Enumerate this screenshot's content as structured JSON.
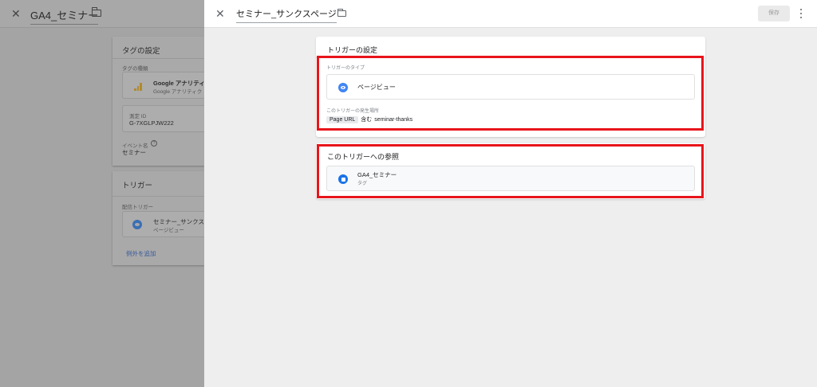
{
  "background": {
    "window_title": "GA4_セミナー",
    "tag_config": {
      "title": "タグの設定",
      "tag_type_label": "タグの種類",
      "tag_name": "Google アナリティ",
      "tag_sub": "Google アナリティク",
      "measure_label": "測定 ID",
      "measure_id": "G-7XGLPJW222",
      "event_label": "イベント名",
      "event_value": "セミナー",
      "tag_icon": "google-analytics-icon"
    },
    "trigger": {
      "title": "トリガー",
      "firing_label": "配信トリガー",
      "trigger_name": "セミナー_サンクス",
      "trigger_type": "ページビュー",
      "add_exception": "例外を追加"
    }
  },
  "panel": {
    "title": "セミナー_サンクスページ",
    "save_label": "保存",
    "trigger_settings": {
      "title": "トリガーの設定",
      "type_label": "トリガーのタイプ",
      "type_value": "ページビュー",
      "fires_on_label": "このトリガーの発生場所",
      "condition": {
        "variable": "Page URL",
        "operator": "含む",
        "value": "seminar-thanks"
      }
    },
    "references": {
      "title": "このトリガーへの参照",
      "items": [
        {
          "name": "GA4_セミナー",
          "kind": "タグ"
        }
      ]
    }
  },
  "colors": {
    "highlight": "#e8141b",
    "accent": "#4285f4",
    "overlay": "#a4a4a4"
  }
}
